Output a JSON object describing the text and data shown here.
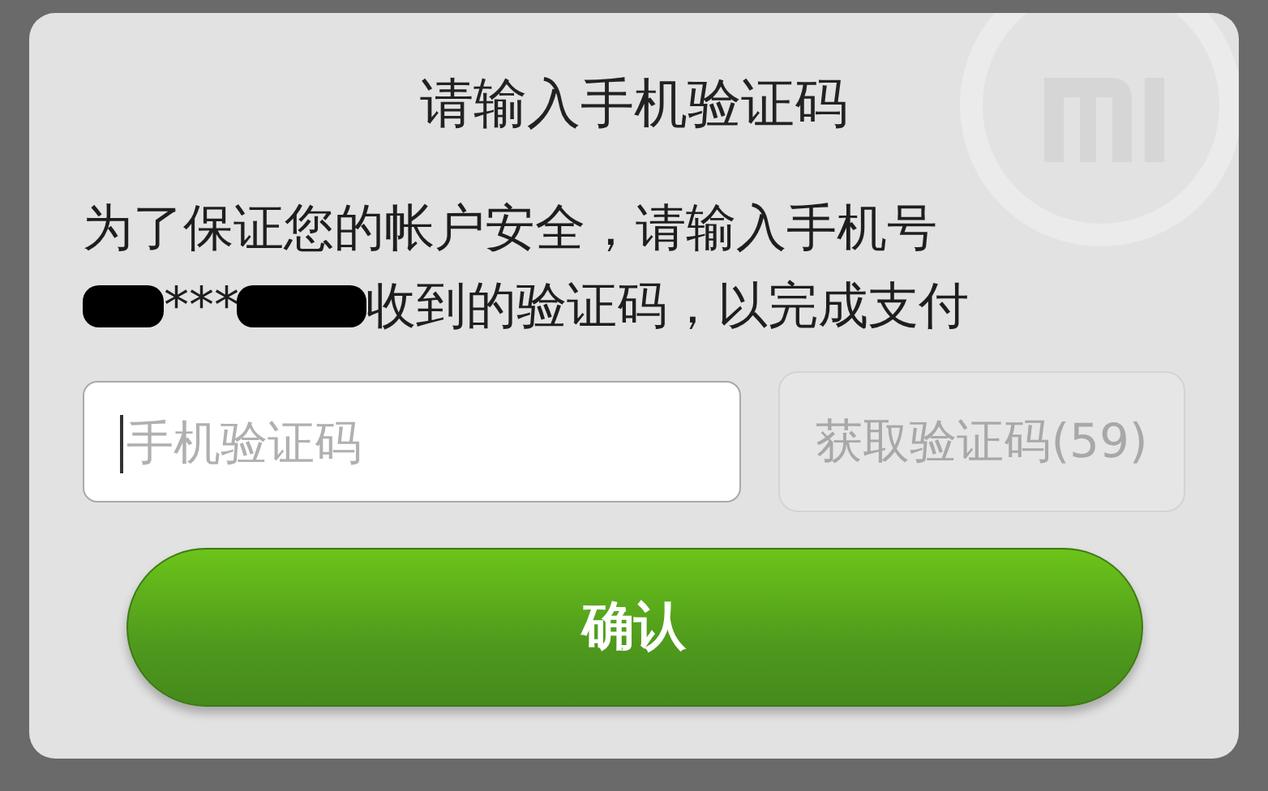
{
  "dialog": {
    "title": "请输入手机验证码",
    "message_line_1": "为了保证您的帐户安全，请输入手机号",
    "message_line_2": {
      "masked": "***",
      "text": "收到的验证码，以完成支付"
    },
    "code_field": {
      "placeholder": "手机验证码"
    },
    "get_code_button": {
      "label": "获取验证码(59)",
      "disabled": true
    },
    "confirm_button": {
      "label": "确认"
    }
  }
}
